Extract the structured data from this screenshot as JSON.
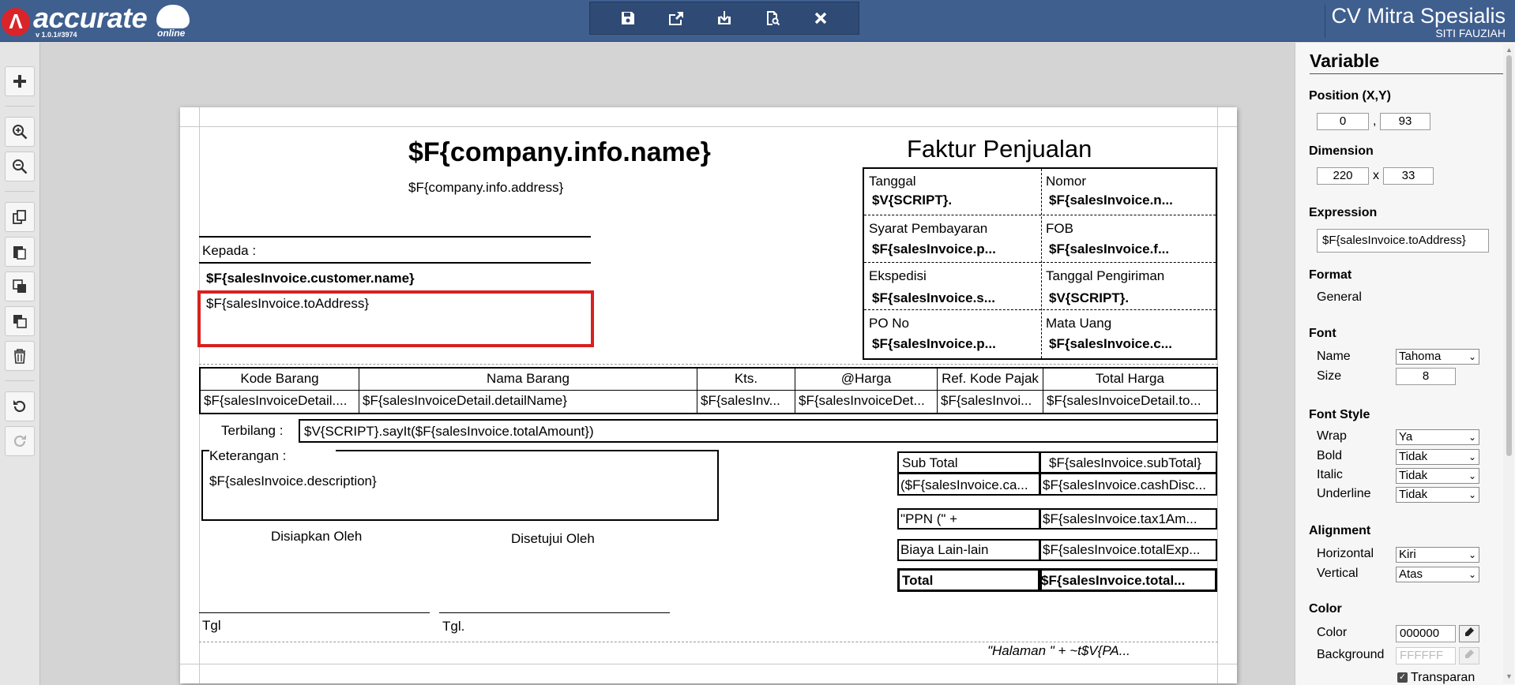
{
  "header": {
    "brand": "accurate",
    "brand_sub": "online",
    "version": "v 1.0.1#3974",
    "company_name": "CV Mitra Spesialis",
    "user_name": "SITI FAUZIAH",
    "toolbar_icons": [
      "save-icon",
      "export-icon",
      "import-icon",
      "preview-icon",
      "close-icon"
    ]
  },
  "left_toolbar": {
    "icons": [
      "add-icon",
      "zoom-in-icon",
      "zoom-out-icon",
      "copy-icon",
      "paste-icon",
      "bring-front-icon",
      "send-back-icon",
      "delete-icon",
      "undo-icon",
      "redo-icon"
    ]
  },
  "report": {
    "company_name": "$F{company.info.name}",
    "company_address": "$F{company.info.address}",
    "title": "Faktur Penjualan",
    "kepada_label": "Kepada :",
    "customer_name": "$F{salesInvoice.customer.name}",
    "to_address": "$F{salesInvoice.toAddress}",
    "info": {
      "tanggal_label": "Tanggal",
      "tanggal_value": "$V{SCRIPT}.",
      "nomor_label": "Nomor",
      "nomor_value": "$F{salesInvoice.n...",
      "syarat_label": "Syarat Pembayaran",
      "syarat_value": "$F{salesInvoice.p...",
      "fob_label": "FOB",
      "fob_value": "$F{salesInvoice.f...",
      "ekspedisi_label": "Ekspedisi",
      "ekspedisi_value": "$F{salesInvoice.s...",
      "tgl_kirim_label": "Tanggal Pengiriman",
      "tgl_kirim_value": "$V{SCRIPT}.",
      "po_label": "PO No",
      "po_value": "$F{salesInvoice.p...",
      "mata_uang_label": "Mata Uang",
      "mata_uang_value": "$F{salesInvoice.c..."
    },
    "table": {
      "headers": [
        "Kode Barang",
        "Nama Barang",
        "Kts.",
        "@Harga",
        "Ref. Kode Pajak",
        "Total Harga"
      ],
      "row": [
        "$F{salesInvoiceDetail....",
        "$F{salesInvoiceDetail.detailName}",
        "$F{salesInv...",
        "$F{salesInvoiceDet...",
        "$F{salesInvoi...",
        "$F{salesInvoiceDetail.to..."
      ]
    },
    "terbilang_label": "Terbilang :",
    "terbilang_value": "$V{SCRIPT}.sayIt($F{salesInvoice.totalAmount})",
    "keterangan_label": "Keterangan :",
    "description": "$F{salesInvoice.description}",
    "disiapkan": "Disiapkan Oleh",
    "disetujui": "Disetujui Oleh",
    "tgl1": "Tgl",
    "tgl2": "Tgl.",
    "totals": {
      "subtotal_label": "Sub Total",
      "subtotal_value": "$F{salesInvoice.subTotal}",
      "disc_label": "($F{salesInvoice.ca...",
      "disc_value": "$F{salesInvoice.cashDisc...",
      "ppn_label": "\"PPN (\" +",
      "ppn_value": "$F{salesInvoice.tax1Am...",
      "biaya_label": "Biaya Lain-lain",
      "biaya_value": "$F{salesInvoice.totalExp...",
      "total_label": "Total",
      "total_value": "$F{salesInvoice.total..."
    },
    "footer": "\"Halaman \" +  ~t$V{PA..."
  },
  "panel": {
    "title": "Variable",
    "position_label": "Position (X,Y)",
    "pos_x": "0",
    "pos_sep": ",",
    "pos_y": "93",
    "dimension_label": "Dimension",
    "dim_w": "220",
    "dim_sep": "x",
    "dim_h": "33",
    "expression_label": "Expression",
    "expression_value": "$F{salesInvoice.toAddress}",
    "format_label": "Format",
    "format_value": "General",
    "font_label": "Font",
    "font_name_label": "Name",
    "font_name_value": "Tahoma",
    "font_size_label": "Size",
    "font_size_value": "8",
    "font_style_label": "Font Style",
    "wrap_label": "Wrap",
    "wrap_value": "Ya",
    "bold_label": "Bold",
    "bold_value": "Tidak",
    "italic_label": "Italic",
    "italic_value": "Tidak",
    "underline_label": "Underline",
    "underline_value": "Tidak",
    "alignment_label": "Alignment",
    "horizontal_label": "Horizontal",
    "horizontal_value": "Kiri",
    "vertical_label": "Vertical",
    "vertical_value": "Atas",
    "color_section": "Color",
    "color_label": "Color",
    "color_value": "000000",
    "background_label": "Background",
    "background_value": "FFFFFF",
    "transparan_label": "Transparan"
  },
  "colors": {
    "header_bg": "#3f5f8f",
    "selection": "#d8201f",
    "logo_red": "#d9252a"
  }
}
